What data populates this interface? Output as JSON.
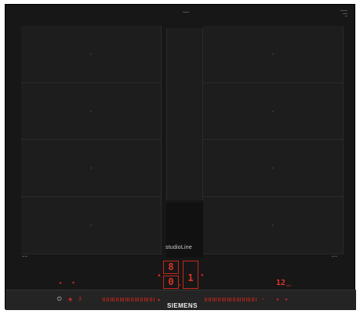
{
  "brand": "SIEMENS",
  "product_line": "studioLine",
  "colors": {
    "glass": "#171717",
    "zone": "#1d1d1d",
    "display_red": "#d22a1f",
    "text": "#ececec"
  },
  "displays": {
    "center_top_digit": "8",
    "center_left_digit": "0",
    "center_right_digit": "1",
    "timer_value": "12",
    "timer_unit": "min"
  },
  "controls": {
    "power_icon": "power-icon",
    "left_slider_ticks": 28,
    "right_slider_ticks": 28
  }
}
